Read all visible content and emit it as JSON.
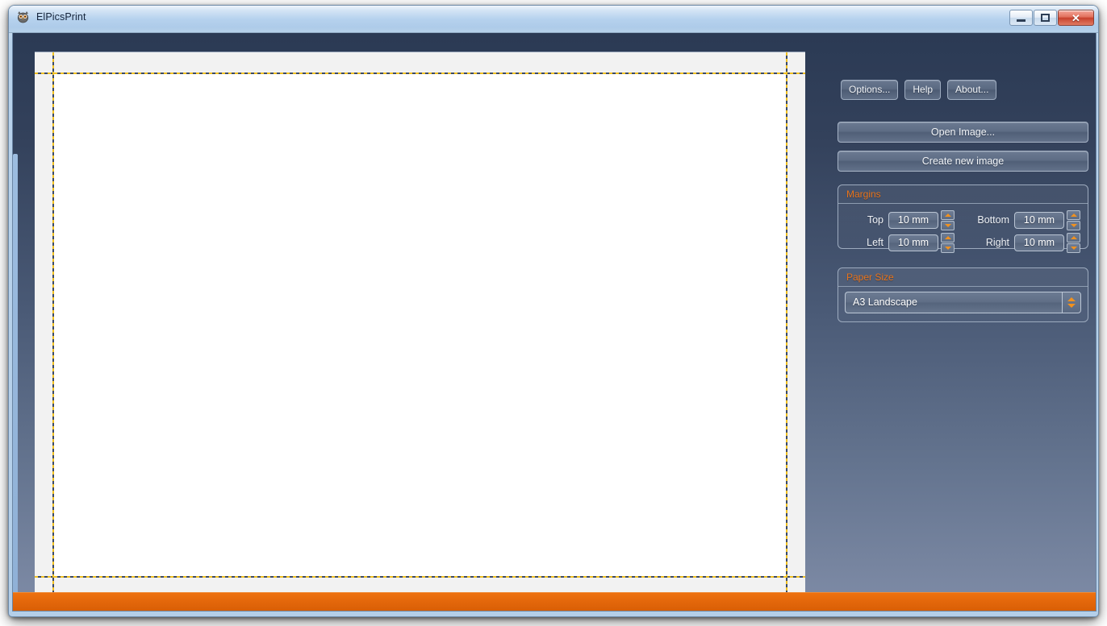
{
  "window": {
    "title": "ElPicsPrint",
    "icon": "owl-icon",
    "controls": {
      "minimize": "minimize-icon",
      "maximize": "maximize-icon",
      "close": "✕"
    }
  },
  "colors": {
    "accent_orange": "#e8731a",
    "status_bar": "#e2660a",
    "panel_top": "#2b3a54",
    "panel_bottom": "#7d8aa5",
    "guide_yellow": "#f0c022",
    "guide_dark": "#3c4a66"
  },
  "panel": {
    "top_buttons": [
      {
        "label": "Options...",
        "name": "options-button"
      },
      {
        "label": "Help",
        "name": "help-button"
      },
      {
        "label": "About...",
        "name": "about-button"
      }
    ],
    "open_image_label": "Open Image...",
    "create_image_label": "Create new image",
    "margins": {
      "title": "Margins",
      "top": {
        "label": "Top",
        "value": "10 mm"
      },
      "bottom": {
        "label": "Bottom",
        "value": "10 mm"
      },
      "left": {
        "label": "Left",
        "value": "10 mm"
      },
      "right": {
        "label": "Right",
        "value": "10 mm"
      }
    },
    "paper_size": {
      "title": "Paper Size",
      "selected": "A3 Landscape"
    }
  },
  "preview": {
    "page_background": "#ffffff",
    "sheet_background": "#f2f2f2"
  }
}
